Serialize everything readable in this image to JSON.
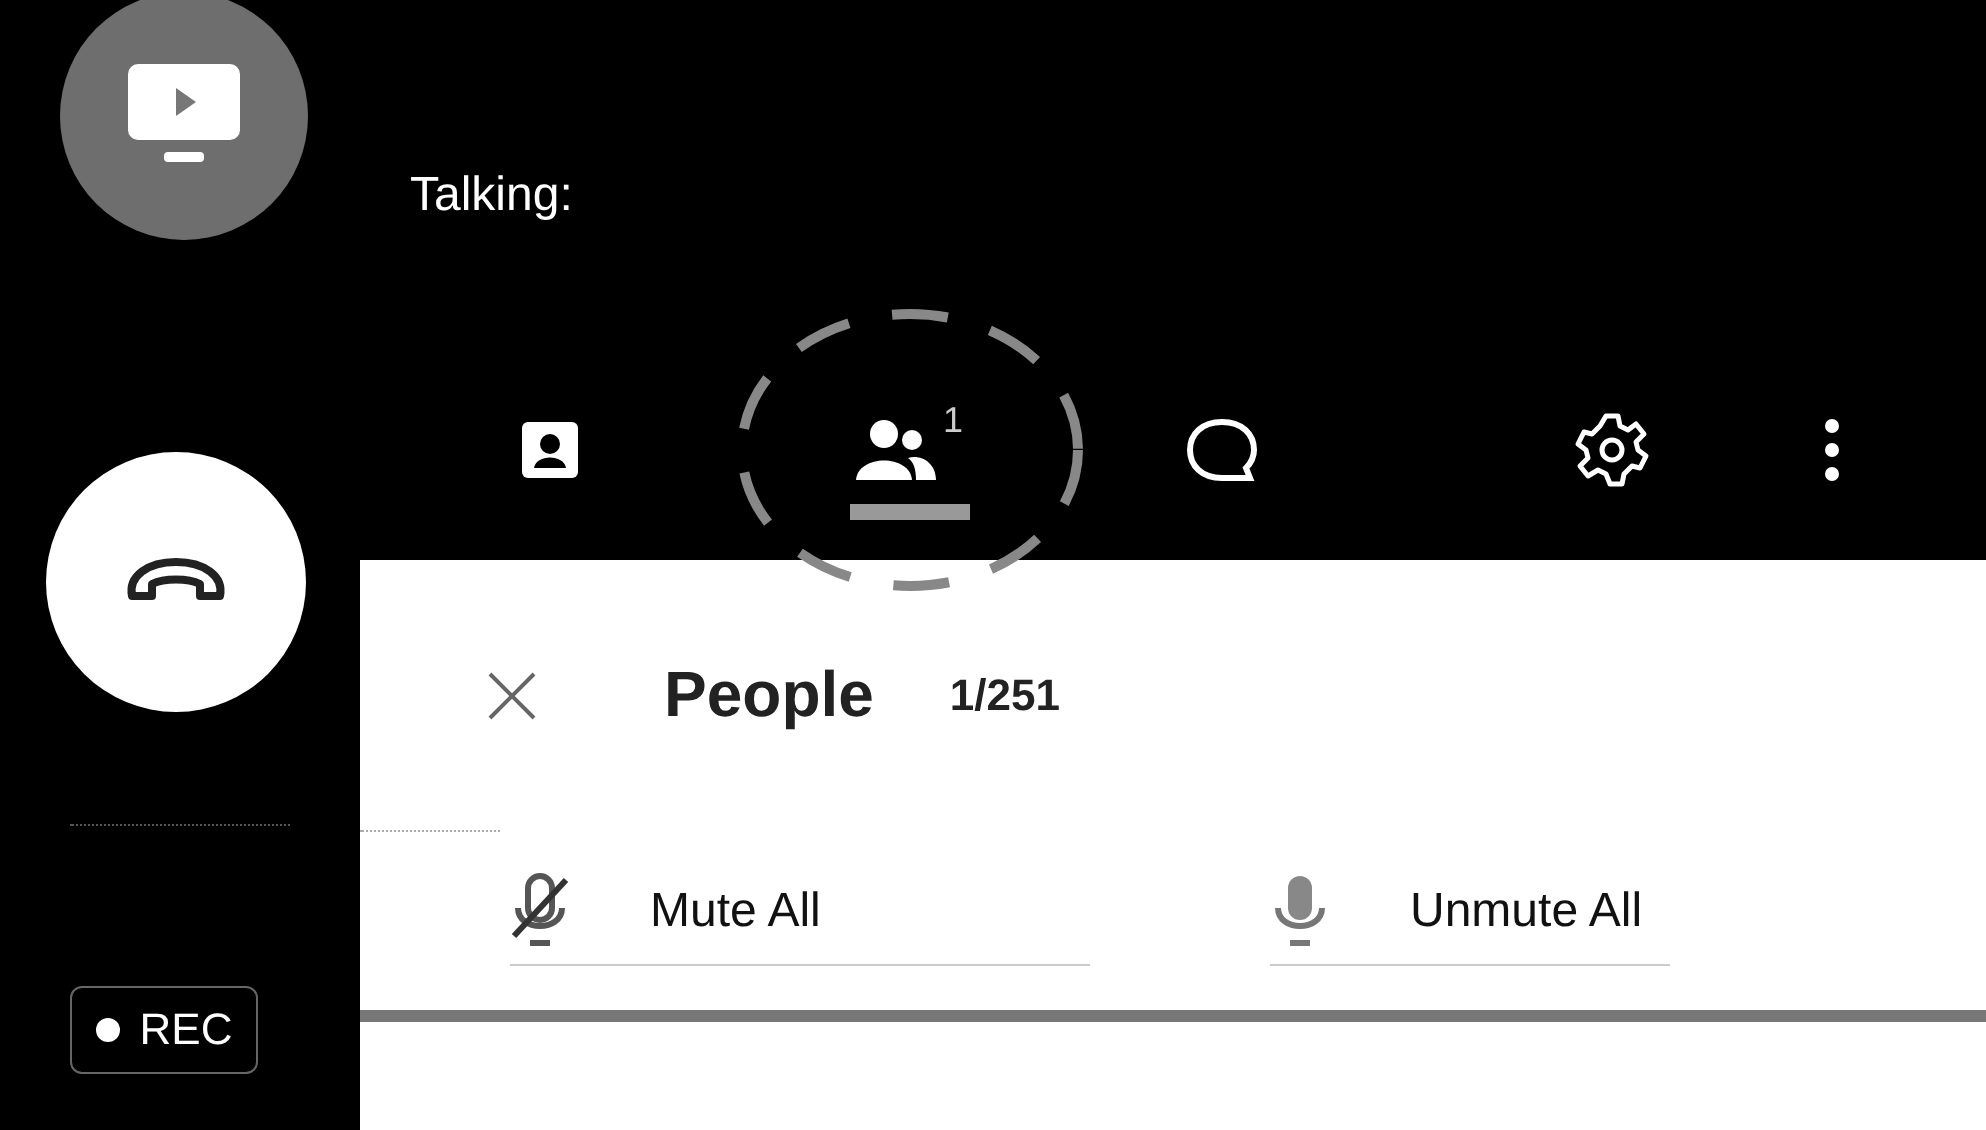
{
  "sidebar": {
    "rec_label": "REC"
  },
  "header": {
    "talking_label": "Talking:"
  },
  "toolbar": [
    {
      "kind": "profile",
      "selected": false
    },
    {
      "kind": "people",
      "badge": "1",
      "selected": true
    },
    {
      "kind": "chat",
      "selected": false
    },
    {
      "kind": "settings",
      "selected": false
    },
    {
      "kind": "more",
      "selected": false
    }
  ],
  "panel": {
    "title": "People",
    "count": "1/251",
    "actions": [
      {
        "kind": "mute",
        "label": "Mute All"
      },
      {
        "kind": "unmute",
        "label": "Unmute All"
      }
    ]
  }
}
